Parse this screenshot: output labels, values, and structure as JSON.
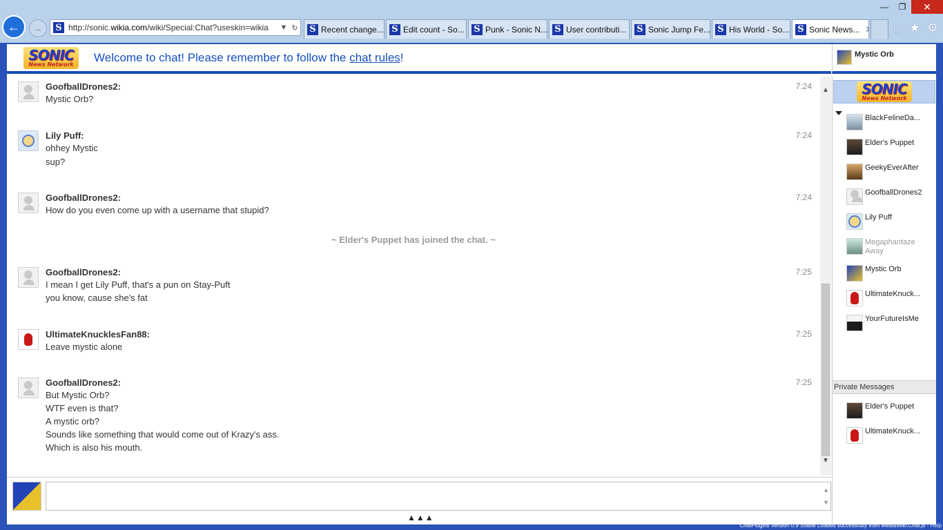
{
  "browser": {
    "url_prefix": "http://sonic.",
    "url_domain": "wikia.com",
    "url_suffix": "/wiki/Special:Chat?useskin=wikia",
    "tabs": [
      {
        "label": "Recent change..."
      },
      {
        "label": "Edit count - So..."
      },
      {
        "label": "Punk - Sonic N..."
      },
      {
        "label": "User contributi..."
      },
      {
        "label": "Sonic Jump Fe..."
      },
      {
        "label": "His World - So..."
      },
      {
        "label": "Sonic News..."
      }
    ],
    "favicon_glyph": "S"
  },
  "header": {
    "logo_big": "SONIC",
    "logo_small": "News Network",
    "welcome_pre": "Welcome to chat! Please remember to follow the ",
    "welcome_link": "chat rules",
    "welcome_post": "!"
  },
  "current_user": {
    "name": "Mystic Orb"
  },
  "messages": [
    {
      "user": "GoofballDrones2:",
      "time": "7:24",
      "lines": [
        "Mystic Orb?"
      ]
    },
    {
      "user": "Lily Puff:",
      "time": "7:24",
      "lines": [
        "ohhey Mystic",
        "sup?"
      ]
    },
    {
      "user": "GoofballDrones2:",
      "time": "7:24",
      "lines": [
        "How do you even come up with a username that stupid?"
      ]
    },
    {
      "user": "GoofballDrones2:",
      "time": "7:25",
      "lines": [
        "I mean I get Lily Puff, that's a pun on Stay-Puft",
        "you know, cause she's fat"
      ]
    },
    {
      "user": "UltimateKnucklesFan88:",
      "time": "7:25",
      "lines": [
        "Leave mystic alone"
      ]
    },
    {
      "user": "GoofballDrones2:",
      "time": "7:25",
      "lines": [
        "But Mystic Orb?",
        "WTF even is that?",
        "A mystic orb?",
        "Sounds like something that would come out of Krazy's ass.",
        "Which is also his mouth."
      ]
    }
  ],
  "inline_alert": "~ Elder's Puppet has joined the chat. ~",
  "users": [
    {
      "name": "BlackFelineDa...",
      "status": ""
    },
    {
      "name": "Elder's Puppet",
      "status": ""
    },
    {
      "name": "GeekyEverAfter",
      "status": ""
    },
    {
      "name": "GoofballDrones2",
      "status": ""
    },
    {
      "name": "Lily Puff",
      "status": ""
    },
    {
      "name": "Megaphantaze",
      "status": "Away"
    },
    {
      "name": "Mystic Orb",
      "status": ""
    },
    {
      "name": "UltimateKnuck...",
      "status": ""
    },
    {
      "name": "YourFutureIsMe",
      "status": ""
    }
  ],
  "private_messages": {
    "title": "Private Messages",
    "users": [
      {
        "name": "Elder's Puppet"
      },
      {
        "name": "UltimateKnuck..."
      }
    ]
  },
  "input": {
    "expand_label": "▲▲▲"
  },
  "status_bar": {
    "text": "ChatPlugins Version 0.9 Stable Loaded successfully from MediaWiki:Chat.js - ",
    "help": "Help"
  }
}
